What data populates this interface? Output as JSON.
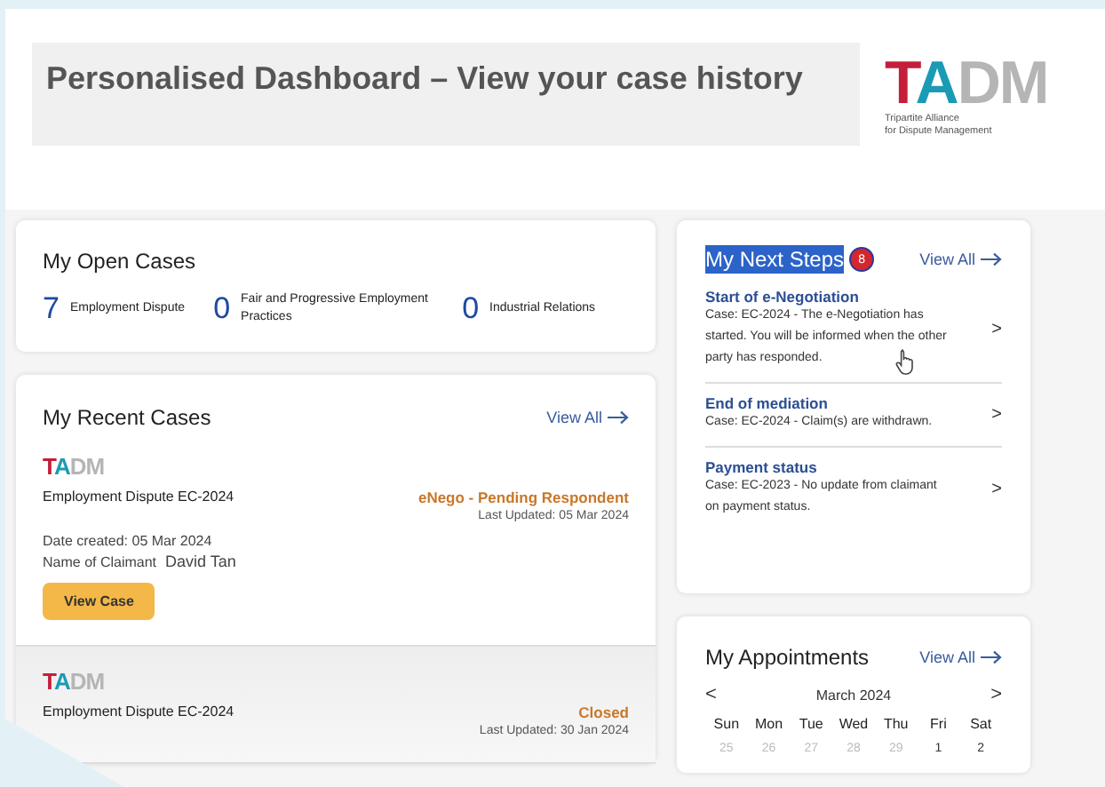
{
  "header": {
    "title": "Personalised Dashboard – View your case history",
    "logo": {
      "letters": [
        {
          "text": "T",
          "color": "#c41e3a"
        },
        {
          "text": "A",
          "color": "#1a9bb5"
        },
        {
          "text": "D",
          "color": "#b5b5b5"
        },
        {
          "text": "M",
          "color": "#b5b5b5"
        }
      ],
      "tagline": [
        "Tripartite Alliance",
        "for Dispute Management"
      ]
    }
  },
  "open_cases": {
    "title": "My Open Cases",
    "items": [
      {
        "count": "7",
        "label": "Employment Dispute"
      },
      {
        "count": "0",
        "label": "Fair and Progressive Employment Practices"
      },
      {
        "count": "0",
        "label": "Industrial Relations"
      }
    ]
  },
  "recent_cases": {
    "title": "My Recent Cases",
    "view_all": "View All",
    "cases": [
      {
        "logo": [
          {
            "text": "T",
            "color": "#c41e3a"
          },
          {
            "text": "A",
            "color": "#1a9bb5"
          },
          {
            "text": "D",
            "color": "#b5b5b5"
          },
          {
            "text": "M",
            "color": "#b5b5b5"
          }
        ],
        "name": "Employment Dispute EC-2024",
        "status": "eNego - Pending Respondent",
        "updated": "Last Updated: 05 Mar 2024",
        "date_created": "Date created: 05 Mar 2024",
        "claimant_label": "Name of Claimant",
        "claimant": "David Tan",
        "button": "View Case",
        "shaded": false
      },
      {
        "logo": [
          {
            "text": "T",
            "color": "#c41e3a"
          },
          {
            "text": "A",
            "color": "#1a9bb5"
          },
          {
            "text": "D",
            "color": "#b5b5b5"
          },
          {
            "text": "M",
            "color": "#b5b5b5"
          }
        ],
        "name": "Employment Dispute EC-2024",
        "status": "Closed",
        "updated": "Last Updated: 30 Jan 2024",
        "shaded": true
      }
    ]
  },
  "next_steps": {
    "title": "My Next Steps",
    "title_highlighted": true,
    "badge": "8",
    "view_all": "View All",
    "items": [
      {
        "title": "Start of e-Negotiation",
        "text": "Case: EC-2024 - The e-Negotiation has started. You will be informed when the other party has responded.",
        "chevron": ">",
        "cursor": true
      },
      {
        "title": "End of mediation",
        "text": "Case: EC-2024 - Claim(s) are withdrawn.",
        "chevron": ">",
        "cursor": false
      },
      {
        "title": "Payment status",
        "text": "Case: EC-2023 - No update from claimant on payment status.",
        "chevron": ">",
        "cursor": false
      }
    ]
  },
  "appointments": {
    "title": "My Appointments",
    "view_all": "View All",
    "prev": "<",
    "month": "March 2024",
    "next": ">",
    "weekdays": [
      "Sun",
      "Mon",
      "Tue",
      "Wed",
      "Thu",
      "Fri",
      "Sat"
    ],
    "days": [
      {
        "label": "25",
        "outside": true
      },
      {
        "label": "26",
        "outside": true
      },
      {
        "label": "27",
        "outside": true
      },
      {
        "label": "28",
        "outside": true
      },
      {
        "label": "29",
        "outside": true
      },
      {
        "label": "1",
        "outside": false
      },
      {
        "label": "2",
        "outside": false
      }
    ]
  }
}
